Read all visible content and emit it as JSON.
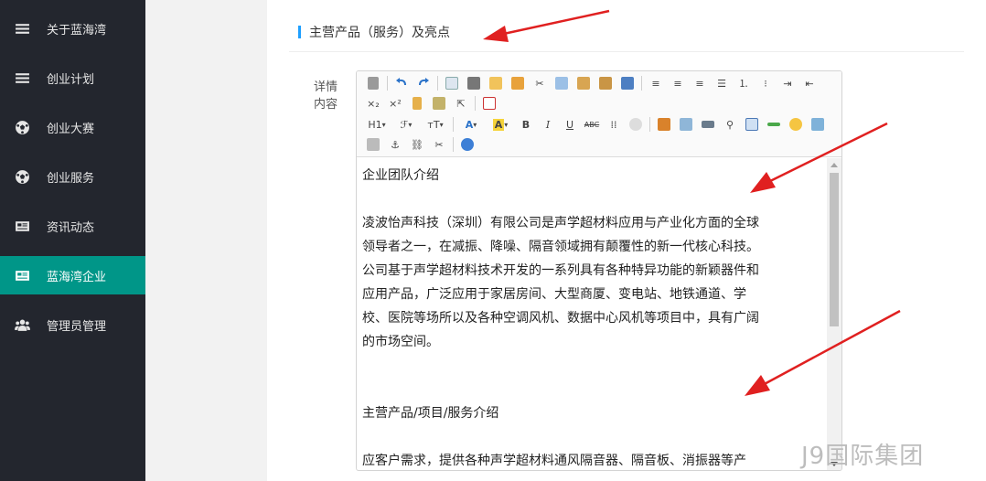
{
  "sidebar": {
    "items": [
      {
        "label": "关于蓝海湾",
        "icon": "menu-icon"
      },
      {
        "label": "创业计划",
        "icon": "menu-icon"
      },
      {
        "label": "创业大赛",
        "icon": "soccer-ball-icon"
      },
      {
        "label": "创业服务",
        "icon": "soccer-ball-icon"
      },
      {
        "label": "资讯动态",
        "icon": "newspaper-icon"
      },
      {
        "label": "蓝海湾企业",
        "icon": "newspaper-icon",
        "active": true
      },
      {
        "label": "管理员管理",
        "icon": "users-icon"
      }
    ],
    "active_color": "#009688"
  },
  "section": {
    "title": "主营产品（服务）及亮点",
    "accent_color": "#1e9fff"
  },
  "field": {
    "label_line1": "详情",
    "label_line2": "内容"
  },
  "toolbar": {
    "heading_label": "H1",
    "font_family_label": "ℱ",
    "font_size_label": "ᴛT",
    "font_color_label": "A",
    "highlight_label": "A",
    "bold_label": "B",
    "italic_label": "I",
    "underline_label": "U",
    "strikethrough_label": "ABC",
    "subscript_label": "×₂",
    "superscript_label": "×²"
  },
  "editor": {
    "lines": [
      "企业团队介绍",
      "",
      "凌波怡声科技（深圳）有限公司是声学超材料应用与产业化方面的全球",
      "领导者之一，在减振、降噪、隔音领域拥有颠覆性的新一代核心科技。",
      "公司基于声学超材料技术开发的一系列具有各种特异功能的新颖器件和",
      "应用产品，广泛应用于家居房间、大型商厦、变电站、地铁通道、学",
      "校、医院等场所以及各种空调风机、数据中心风机等项目中，具有广阔",
      "的市场空间。",
      "",
      "",
      "主营产品/项目/服务介绍",
      "",
      "应客户需求，提供各种声学超材料通风隔音器、隔音板、消振器等产"
    ]
  },
  "annotation_color": "#e02020",
  "watermark": "J9国际集团"
}
